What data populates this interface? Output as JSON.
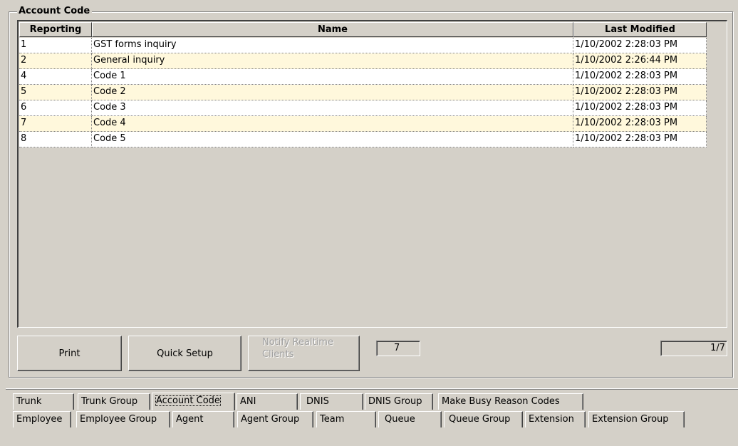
{
  "groupbox": {
    "title": "Account Code"
  },
  "grid": {
    "headers": {
      "reporting": "Reporting",
      "name": "Name",
      "last_modified": "Last Modified"
    },
    "rows": [
      {
        "reporting": "1",
        "name": "GST forms inquiry",
        "last_modified": "1/10/2002 2:28:03 PM"
      },
      {
        "reporting": "2",
        "name": "General inquiry",
        "last_modified": "1/10/2002 2:26:44 PM"
      },
      {
        "reporting": "4",
        "name": "Code 1",
        "last_modified": "1/10/2002 2:28:03 PM"
      },
      {
        "reporting": "5",
        "name": "Code 2",
        "last_modified": "1/10/2002 2:28:03 PM"
      },
      {
        "reporting": "6",
        "name": "Code 3",
        "last_modified": "1/10/2002 2:28:03 PM"
      },
      {
        "reporting": "7",
        "name": "Code 4",
        "last_modified": "1/10/2002 2:28:03 PM"
      },
      {
        "reporting": "8",
        "name": "Code 5",
        "last_modified": "1/10/2002 2:28:03 PM"
      }
    ]
  },
  "buttons": {
    "print": "Print",
    "quick_setup": "Quick Setup",
    "notify_line1": "Notify Realtime",
    "notify_line2": "Clients"
  },
  "record_count": "7",
  "page_indicator": "1/7",
  "tabs": {
    "row1": [
      "Trunk",
      "Trunk Group",
      "Account Code",
      "ANI",
      "DNIS",
      "DNIS Group",
      "Make Busy Reason Codes"
    ],
    "row2": [
      "Employee",
      "Employee Group",
      "Agent",
      "Agent Group",
      "Team",
      "Queue",
      "Queue Group",
      "Extension",
      "Extension Group"
    ],
    "active": "Account Code"
  }
}
